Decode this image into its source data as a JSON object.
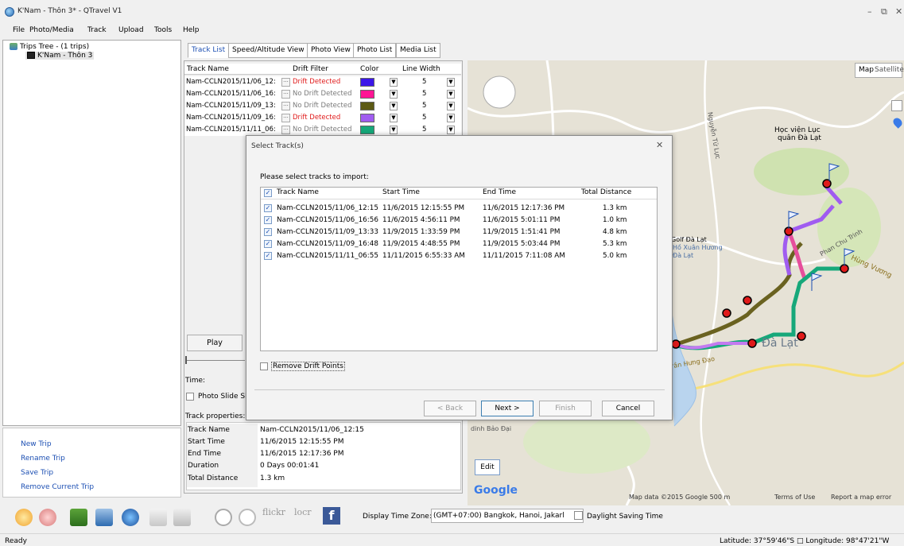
{
  "window": {
    "title": "K'Nam - Thôn 3* - QTravel V1",
    "minimize": "–",
    "restore": "⧉",
    "close": "✕"
  },
  "menu": [
    "File",
    "Photo/Media",
    "Track",
    "Upload",
    "Tools",
    "Help"
  ],
  "tree": {
    "root": "Trips Tree - (1 trips)",
    "child": "K'Nam - Thôn 3"
  },
  "left_links": [
    "New Trip",
    "Rename Trip",
    "Save Trip",
    "Remove Current Trip"
  ],
  "tabs": [
    "Track List",
    "Speed/Altitude View",
    "Photo View",
    "Photo List",
    "Media List"
  ],
  "grid": {
    "headers": [
      "Track Name",
      "Drift Filter",
      "Color",
      "Line Width"
    ],
    "rows": [
      {
        "name": "Nam-CCLN2015/11/06_12:",
        "drift": "Drift Detected",
        "color": "#3b17e8",
        "width": "5",
        "drift_color": "#e01a1a"
      },
      {
        "name": "Nam-CCLN2015/11/06_16:",
        "drift": "No Drift Detected",
        "color": "#ff1494",
        "width": "5",
        "drift_color": "#7a7a7a"
      },
      {
        "name": "Nam-CCLN2015/11/09_13:",
        "drift": "No Drift Detected",
        "color": "#5c5a14",
        "width": "5",
        "drift_color": "#7a7a7a"
      },
      {
        "name": "Nam-CCLN2015/11/09_16:",
        "drift": "Drift Detected",
        "color": "#a05cf0",
        "width": "5",
        "drift_color": "#e01a1a"
      },
      {
        "name": "Nam-CCLN2015/11/11_06:",
        "drift": "No Drift Detected",
        "color": "#16a87a",
        "width": "5",
        "drift_color": "#7a7a7a"
      }
    ]
  },
  "play_label": "Play",
  "time_label": "Time:",
  "slide_label": "Photo Slide Sh",
  "props": {
    "title": "Track properties:",
    "rows": [
      {
        "k": "Track Name",
        "v": "Nam-CCLN2015/11/06_12:15"
      },
      {
        "k": "Start Time",
        "v": "11/6/2015 12:15:55 PM"
      },
      {
        "k": "End Time",
        "v": "11/6/2015 12:17:36 PM"
      },
      {
        "k": "Duration",
        "v": "0 Days 00:01:41"
      },
      {
        "k": "Total Distance",
        "v": "1.3 km"
      }
    ]
  },
  "dialog": {
    "title": "Select Track(s)",
    "close": "✕",
    "prompt": "Please select tracks to import:",
    "headers": [
      "Track Name",
      "Start Time",
      "End Time",
      "Total Distance"
    ],
    "rows": [
      {
        "name": "Nam-CCLN2015/11/06_12:15",
        "start": "11/6/2015 12:15:55 PM",
        "end": "11/6/2015 12:17:36 PM",
        "dist": "1.3 km"
      },
      {
        "name": "Nam-CCLN2015/11/06_16:56",
        "start": "11/6/2015 4:56:11 PM",
        "end": "11/6/2015 5:01:11 PM",
        "dist": "1.0 km"
      },
      {
        "name": "Nam-CCLN2015/11/09_13:33",
        "start": "11/9/2015 1:33:59 PM",
        "end": "11/9/2015 1:51:41 PM",
        "dist": "4.8 km"
      },
      {
        "name": "Nam-CCLN2015/11/09_16:48",
        "start": "11/9/2015 4:48:55 PM",
        "end": "11/9/2015 5:03:44 PM",
        "dist": "5.3 km"
      },
      {
        "name": "Nam-CCLN2015/11/11_06:55",
        "start": "11/11/2015 6:55:33 AM",
        "end": "11/11/2015 7:11:08 AM",
        "dist": "5.0 km"
      }
    ],
    "remove_drift": "Remove Drift Points",
    "back": "< Back",
    "next": "Next >",
    "finish": "Finish",
    "cancel": "Cancel"
  },
  "map": {
    "map_btn": "Map",
    "satellite_btn": "Satellite",
    "edit_btn": "Edit",
    "google": "Google",
    "footer": "Map data ©2015 Google   500 m",
    "terms": "Terms of Use",
    "report": "Report a map error",
    "labels": [
      "Học viện Lục",
      "quân Đà Lạt",
      "Golf Đà Lạt",
      "Hồ Xuân Hương",
      "Đà Lạt",
      "Phan Chu Trinh",
      "Hùng Vương",
      "Trần Hưng Đạo",
      "Nguyễn Tử Lực",
      "dinh Bảo Đại",
      "Đà Lạt"
    ]
  },
  "toolbar": {
    "tz_label": "Display Time Zone:",
    "tz_value": "(GMT+07:00) Bangkok, Hanoi, Jakarl",
    "dst": "Daylight Saving Time",
    "flickr": "flickr",
    "locr": "locr"
  },
  "status": {
    "ready": "Ready",
    "latlon": "Latitude: 37°59'46\"S □ Longitude: 98°47'21\"W"
  }
}
